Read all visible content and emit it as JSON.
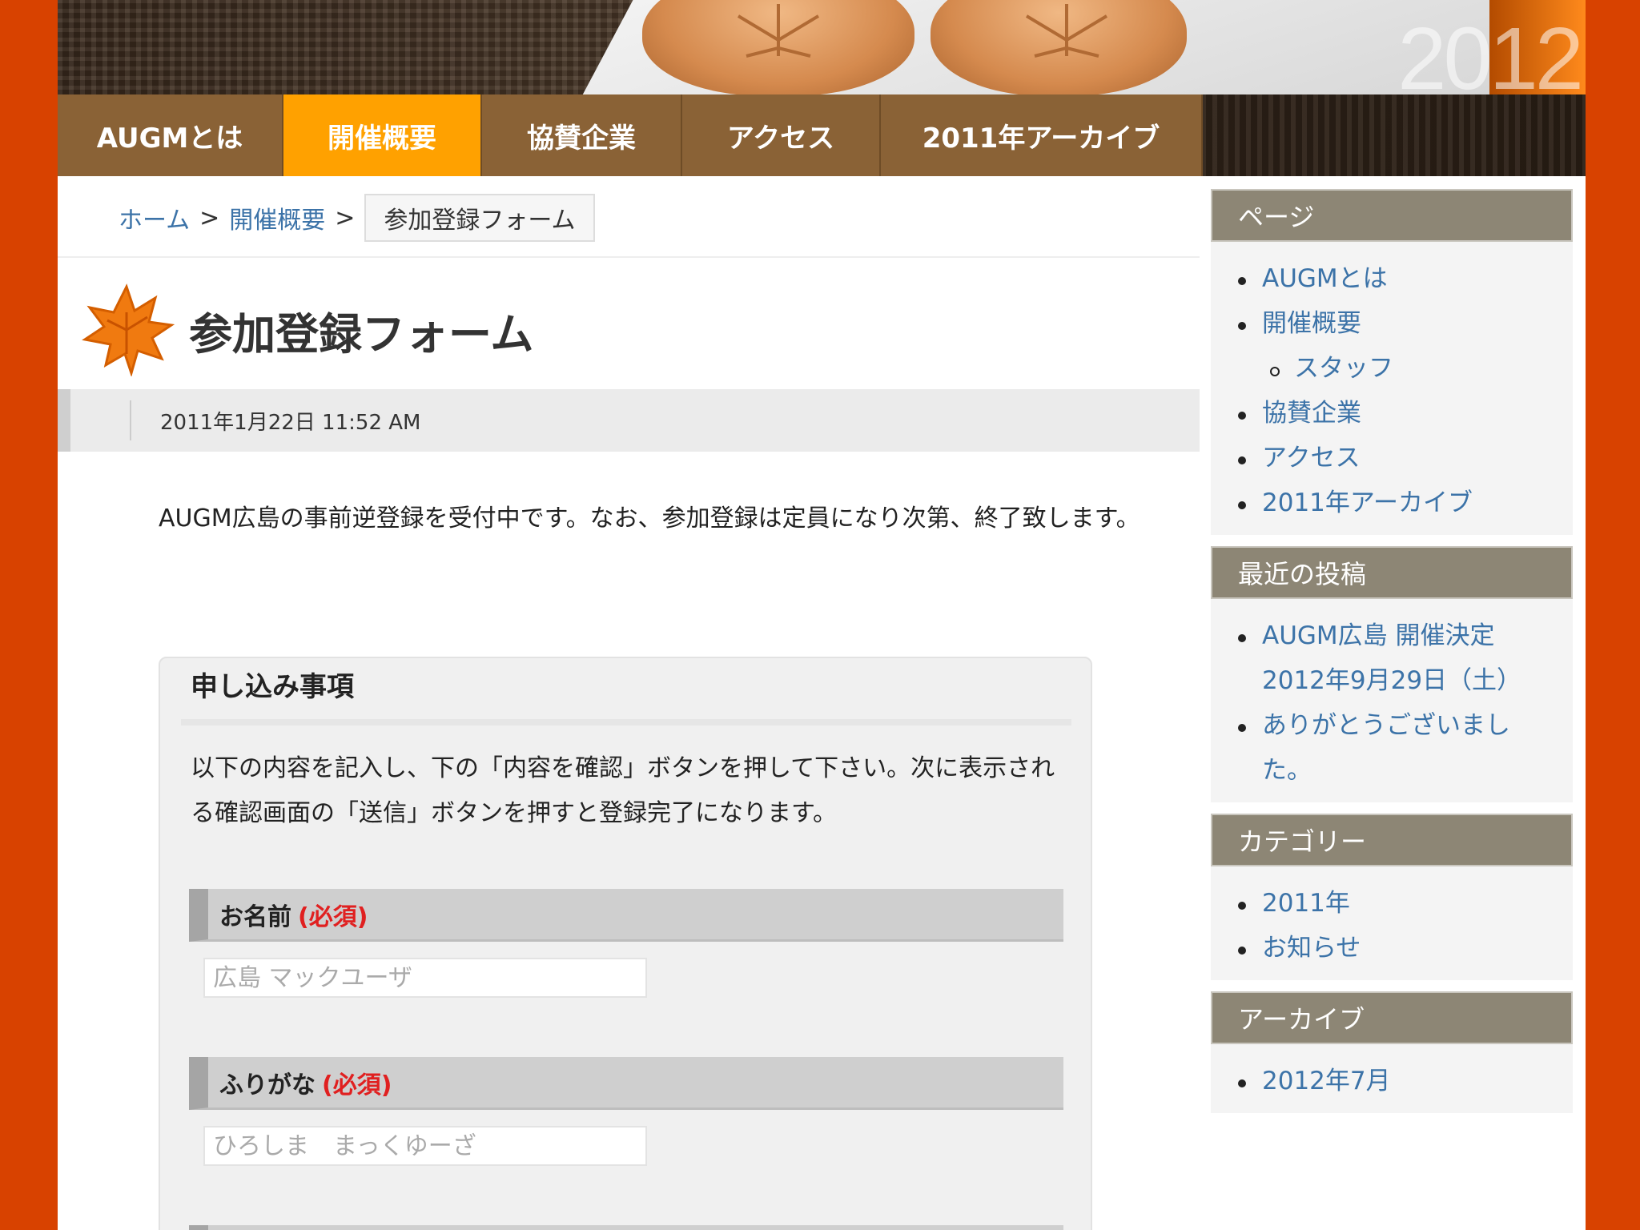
{
  "banner": {
    "year_mark": "2012"
  },
  "nav": {
    "items": [
      {
        "label": "AUGMとは",
        "active": false
      },
      {
        "label": "開催概要",
        "active": true
      },
      {
        "label": "協賛企業",
        "active": false
      },
      {
        "label": "アクセス",
        "active": false
      },
      {
        "label": "2011年アーカイブ",
        "active": false
      }
    ]
  },
  "breadcrumb": {
    "home": "ホーム",
    "separator": ">",
    "parent": "開催概要",
    "current": "参加登録フォーム"
  },
  "post": {
    "title": "参加登録フォーム",
    "date": "2011年1月22日 11:52 AM",
    "lead": "AUGM広島の事前逆登録を受付中です。なお、参加登録は定員になり次第、終了致します。"
  },
  "form": {
    "heading": "申し込み事項",
    "intro": "以下の内容を記入し、下の「内容を確認」ボタンを押して下さい。次に表示される確認画面の「送信」ボタンを押すと登録完了になります。",
    "required_label": "(必須)",
    "fields": [
      {
        "label": "お名前",
        "placeholder": "広島 マックユーザ"
      },
      {
        "label": "ふりがな",
        "placeholder": "ひろしま　まっくゆーざ"
      }
    ]
  },
  "sidebar": {
    "pages": {
      "title": "ページ",
      "items": [
        "AUGMとは",
        "開催概要",
        "スタッフ",
        "協賛企業",
        "アクセス",
        "2011年アーカイブ"
      ]
    },
    "recent": {
      "title": "最近の投稿",
      "items": [
        "AUGM広島 開催決定 2012年9月29日（土）",
        "ありがとうございました。"
      ]
    },
    "categories": {
      "title": "カテゴリー",
      "items": [
        "2011年",
        "お知らせ"
      ]
    },
    "archives": {
      "title": "アーカイブ",
      "items": [
        "2012年7月"
      ]
    }
  },
  "colors": {
    "background": "#d84200",
    "nav": "#8a6236",
    "nav_active": "#ffa100",
    "link": "#3c73a8",
    "widget_title": "#8d8675",
    "required": "#e02020"
  }
}
